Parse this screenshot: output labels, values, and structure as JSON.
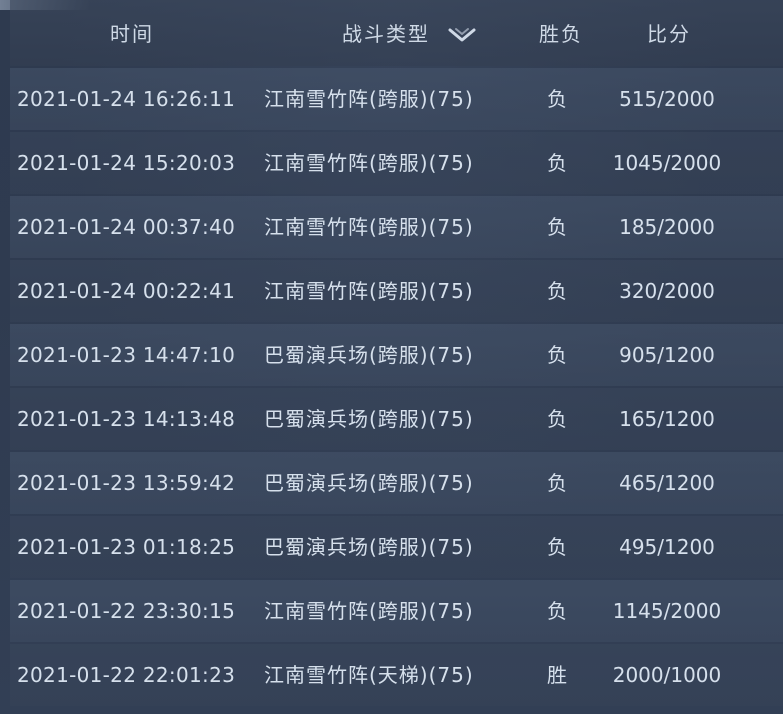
{
  "header": {
    "time_label": "时间",
    "type_label": "战斗类型",
    "result_label": "胜负",
    "score_label": "比分",
    "filter_icon": "chevron-down-icon"
  },
  "rows": [
    {
      "time": "2021-01-24 16:26:11",
      "type": "江南雪竹阵(跨服)(75)",
      "result": "负",
      "score": "515/2000"
    },
    {
      "time": "2021-01-24 15:20:03",
      "type": "江南雪竹阵(跨服)(75)",
      "result": "负",
      "score": "1045/2000"
    },
    {
      "time": "2021-01-24 00:37:40",
      "type": "江南雪竹阵(跨服)(75)",
      "result": "负",
      "score": "185/2000"
    },
    {
      "time": "2021-01-24 00:22:41",
      "type": "江南雪竹阵(跨服)(75)",
      "result": "负",
      "score": "320/2000"
    },
    {
      "time": "2021-01-23 14:47:10",
      "type": "巴蜀演兵场(跨服)(75)",
      "result": "负",
      "score": "905/1200"
    },
    {
      "time": "2021-01-23 14:13:48",
      "type": "巴蜀演兵场(跨服)(75)",
      "result": "负",
      "score": "165/1200"
    },
    {
      "time": "2021-01-23 13:59:42",
      "type": "巴蜀演兵场(跨服)(75)",
      "result": "负",
      "score": "465/1200"
    },
    {
      "time": "2021-01-23 01:18:25",
      "type": "巴蜀演兵场(跨服)(75)",
      "result": "负",
      "score": "495/1200"
    },
    {
      "time": "2021-01-22 23:30:15",
      "type": "江南雪竹阵(跨服)(75)",
      "result": "负",
      "score": "1145/2000"
    },
    {
      "time": "2021-01-22 22:01:23",
      "type": "江南雪竹阵(天梯)(75)",
      "result": "胜",
      "score": "2000/1000"
    }
  ]
}
